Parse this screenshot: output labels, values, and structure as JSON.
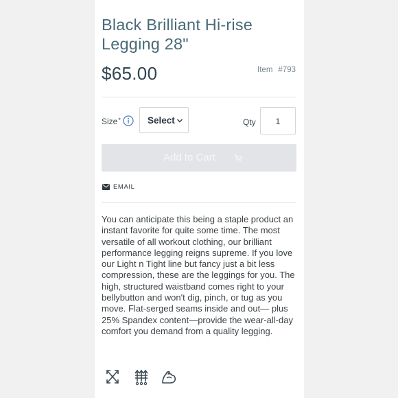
{
  "product": {
    "title": "Black Brilliant Hi-rise Legging 28\"",
    "price": "$65.00",
    "item_label": "Item",
    "item_number": "#793"
  },
  "options": {
    "size_label": "Size",
    "size_required_mark": "*",
    "size_select_value": "Select",
    "qty_label": "Qty",
    "qty_value": "1"
  },
  "actions": {
    "add_to_cart_label": "Add to Cart",
    "email_label": "EMAIL"
  },
  "description": "You can anticipate this being a staple product an instant favorite for quite some time. The most versatile of all workout clothing, our brilliant performance legging reigns supreme. If you love our Light n Tight line but fancy just a bit less compression, these are the leggings for you. The high, structured waistband comes right to your bellybutton and won't dig, pinch, or tug as you move. Flat-serged seams inside and out— plus 25% Spandex content—provide the wear-all-day comfort you demand from a quality legging.",
  "feature_icons": [
    "four-way-stretch-icon",
    "moisture-wicking-icon",
    "muscle-support-icon"
  ],
  "colors": {
    "title": "#4a6a78",
    "price": "#2f4652",
    "button_disabled": "#e2e4e8",
    "page_background": "#f1f1f2"
  }
}
